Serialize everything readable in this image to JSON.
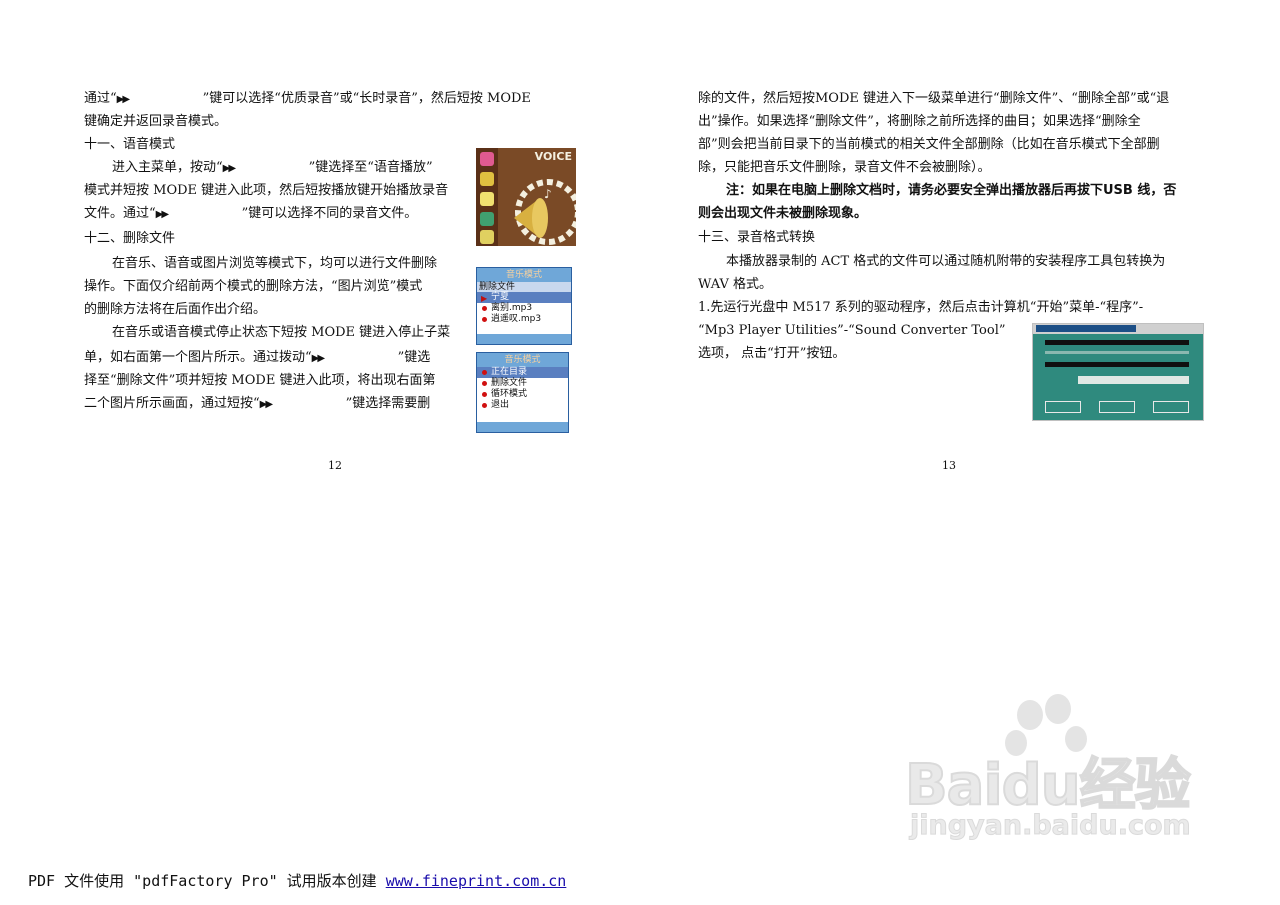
{
  "left_page": {
    "para1_line1_a": "通过“",
    "para1_line1_b": "”键可以选择“优质录音”或“长时录音”，然后短按 MODE",
    "para1_line2": "键确定并返回录音模式。",
    "heading11": "十一、语音模式",
    "para2_line1_a": "进入主菜单，按动“",
    "para2_line1_b": "”键选择至“语音播放”",
    "para2_line2": "模式并短按 MODE 键进入此项，然后短按播放键开始播放录音",
    "para2_line3_a": "文件。通过“",
    "para2_line3_b": "”键可以选择不同的录音文件。",
    "heading12": "十二、删除文件",
    "para3_line1": "在音乐、语音或图片浏览等模式下，均可以进行文件删除",
    "para3_line2": "操作。下面仅介绍前两个模式的删除方法，“图片浏览”模式",
    "para3_line3": "的删除方法将在后面作出介绍。",
    "para4_line1": "在音乐或语音模式停止状态下短按 MODE 键进入停止子菜",
    "para4_line2_a": "单，如右面第一个图片所示。通过拨动“",
    "para4_line2_b": "”键选",
    "para4_line3": "择至“删除文件”项并短按 MODE 键进入此项，将出现右面第",
    "para4_line4_a": "二个图片所示画面，通过短按“",
    "para4_line4_b": "”键选择需要删",
    "ff_glyph": "▶▶",
    "page_number": "12",
    "voice_screen_title": "VOICE",
    "menu1": {
      "header": "音乐模式",
      "subheader": "删除文件",
      "items": [
        "宁夏",
        "离别.mp3",
        "逍遥叹.mp3"
      ]
    },
    "menu2": {
      "header": "音乐模式",
      "items": [
        "正在目录",
        "删除文件",
        "循环模式",
        "退出"
      ]
    }
  },
  "right_page": {
    "line1": "除的文件，然后短按MODE 键进入下一级菜单进行“删除文件”、“删除全部”或“退",
    "line2": "出”操作。如果选择“删除文件”，将删除之前所选择的曲目；如果选择“删除全",
    "line3": "部”则会把当前目录下的当前模式的相关文件全部删除（比如在音乐模式下全部删",
    "line4": "除，只能把音乐文件删除，录音文件不会被删除）。",
    "note_line1": "注：如果在电脑上删除文档时，请务必要安全弹出播放器后再拔下USB 线，否",
    "note_line2": "则会出现文件未被删除现象。",
    "heading13": "十三、录音格式转换",
    "para_line1": "本播放器录制的 ACT 格式的文件可以通过随机附带的安装程序工具包转换为",
    "para_line2": "WAV 格式。",
    "step1_line1": "1.先运行光盘中 M517 系列的驱动程序，然后点击计算机“开始”菜单-“程序”-",
    "step1_line2": "“Mp3 Player Utilities”-“Sound Converter Tool”",
    "step1_line3": "选项， 点击“打开”按钮。",
    "page_number": "13"
  },
  "footer": {
    "text": "PDF 文件使用 \"pdfFactory Pro\" 试用版本创建 ",
    "link": "www.fineprint.com.cn"
  },
  "watermark": {
    "brand": "Baidu经验",
    "url": "jingyan.baidu.com"
  }
}
